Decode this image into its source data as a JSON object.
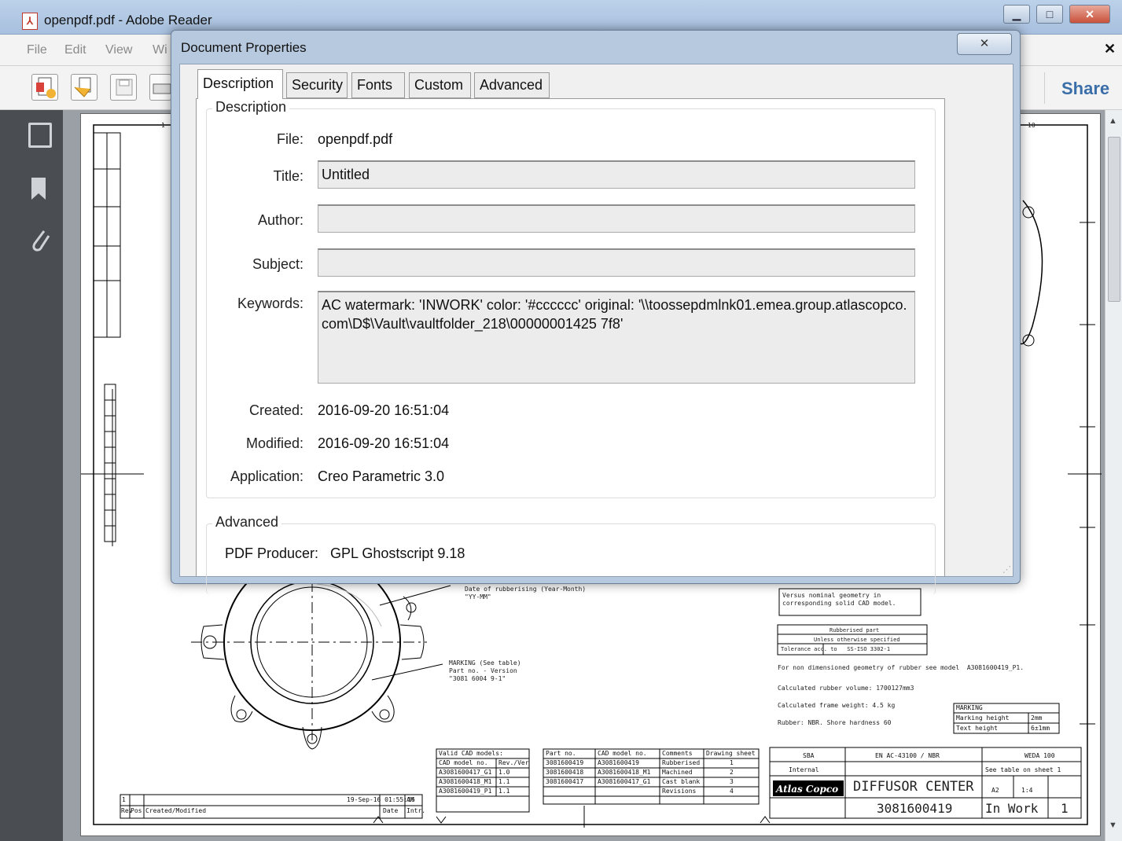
{
  "window": {
    "title": "openpdf.pdf - Adobe Reader",
    "min": "▁",
    "max": "□",
    "close": "✕"
  },
  "menu": {
    "file": "File",
    "edit": "Edit",
    "view": "View",
    "window_partial": "Wi",
    "close_doc": "✕"
  },
  "toolbar": {
    "comment_partial": "t",
    "share": "Share"
  },
  "drawing": {
    "ruler_1": "1",
    "ruler_10": "10",
    "date_note": "Date of rubberising (Year-Month)\n\"YY-MM\"",
    "marking_note": "MARKING (See table)\nPart no. - Version\n\"3081 6004 9-1\"",
    "versus_note": "Versus nominal geometry in\ncorresponding solid CAD model.",
    "rubberised_part": "Rubberised part",
    "unless": "Unless otherwise specified",
    "tolerance": "Tolerance acc. to   SS-ISO 3302-1",
    "non_dim": "For non dimensioned geometry of rubber see model  A3081600419_P1.",
    "calc_volume": "Calculated rubber volume: 1700127mm3",
    "calc_weight": "Calculated frame weight: 4.5 kg",
    "rubber": "Rubber: NBR. Shore hardness 60",
    "marking_table": {
      "title": "MARKING",
      "rows": [
        [
          "Marking height",
          "2mm"
        ],
        [
          "Text height",
          "6±1mm"
        ]
      ]
    },
    "cad_models": {
      "header": [
        "Valid CAD models:",
        ""
      ],
      "col_headers": [
        "CAD model no.",
        "Rev./Ver"
      ],
      "rows": [
        [
          "A3081600417_G1",
          "1.0"
        ],
        [
          "A3081600418_M1",
          "1.1"
        ],
        [
          "A3081600419_P1",
          "1.1"
        ]
      ]
    },
    "parts_table": {
      "headers": [
        "Part no.",
        "CAD model no.",
        "Comments",
        "Drawing sheet"
      ],
      "rows": [
        [
          "3081600419",
          "A3081600419",
          "Rubberised",
          "1"
        ],
        [
          "3081600418",
          "A3081600418_M1",
          "Machined",
          "2"
        ],
        [
          "3081600417",
          "A3081600417_G1",
          "Cast blank",
          "3"
        ],
        [
          "",
          "",
          "Revisions",
          "4"
        ]
      ]
    },
    "rev_row": {
      "rev": "1",
      "date": "19-Sep-16 01:55:16",
      "by": "AM",
      "labels": [
        "Rev",
        "Pos.",
        "Created/Modified",
        "Date",
        "Intr."
      ]
    },
    "title_block": {
      "company": "SBA",
      "material": "EN AC-43100 / NBR",
      "standard": "WEDA 100",
      "confidentiality": "Internal",
      "scale_note": "See table on sheet 1",
      "size": "A2",
      "scale": "1:4",
      "logo": "Atlas Copco",
      "title": "DIFFUSOR CENTER",
      "drawing_no": "3081600419",
      "status": "In Work",
      "sheet": "1"
    }
  },
  "dialog": {
    "title": "Document Properties",
    "close": "✕",
    "tabs": [
      "Description",
      "Security",
      "Fonts",
      "Custom",
      "Advanced"
    ],
    "description": {
      "group": "Description",
      "file_label": "File:",
      "file": "openpdf.pdf",
      "title_label": "Title:",
      "title": "Untitled",
      "author_label": "Author:",
      "author": "",
      "subject_label": "Subject:",
      "subject": "",
      "keywords_label": "Keywords:",
      "keywords": "AC watermark: 'INWORK' color: '#cccccc' original: '\\\\toossepdmlnk01.emea.group.atlascopco.com\\D$\\Vault\\vaultfolder_218\\00000001425 7f8'",
      "created_label": "Created:",
      "created": "2016-09-20 16:51:04",
      "modified_label": "Modified:",
      "modified": "2016-09-20 16:51:04",
      "application_label": "Application:",
      "application": "Creo Parametric 3.0"
    },
    "advanced": {
      "group": "Advanced",
      "producer_label": "PDF Producer:",
      "producer": "GPL Ghostscript 9.18"
    }
  },
  "colors": {
    "share": "#3a6ea8",
    "dialog_frame": "#b7c9de",
    "nav_pane": "#4a4d52"
  }
}
